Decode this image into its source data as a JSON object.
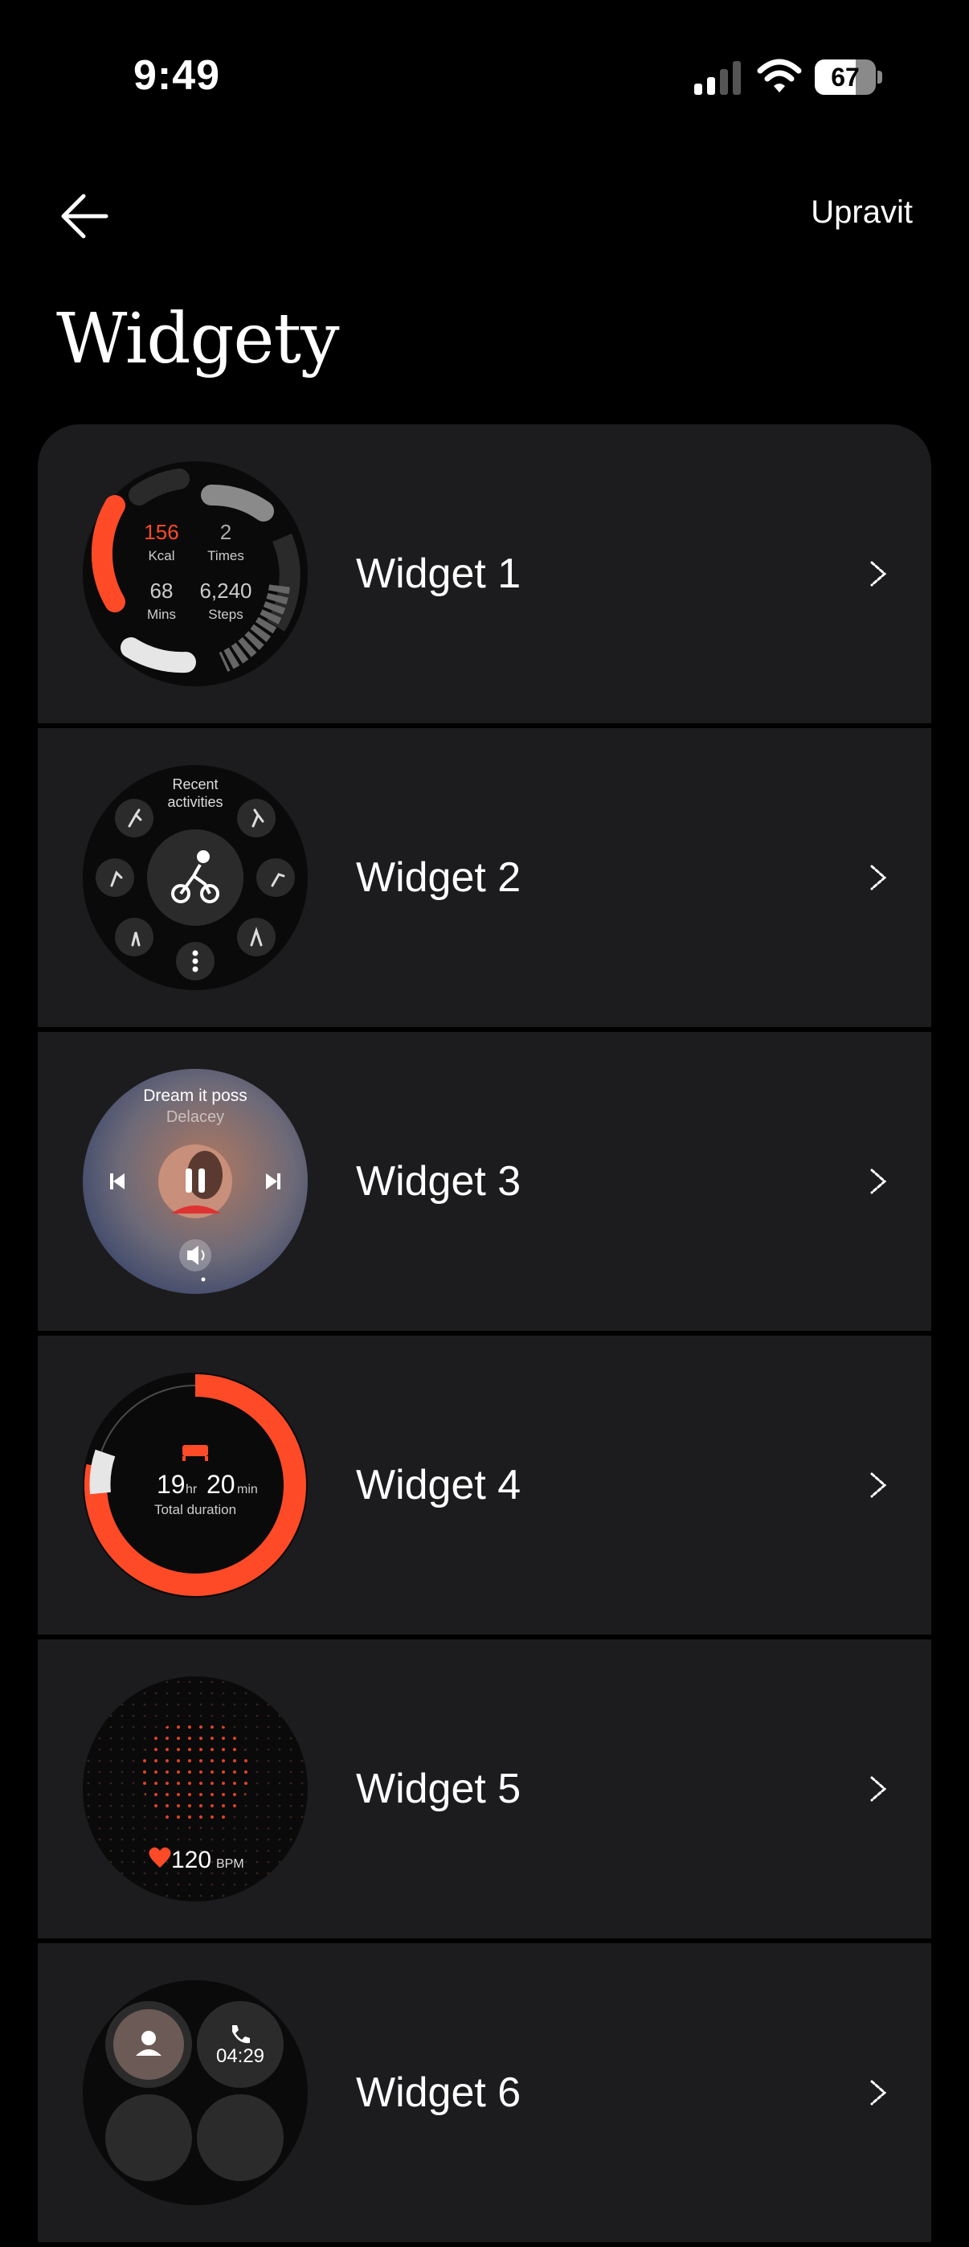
{
  "status_bar": {
    "time": "9:49",
    "battery": "67",
    "battery_level": 0.67
  },
  "header": {
    "edit_label": "Upravit",
    "title": "Widgety"
  },
  "widgets": [
    {
      "label": "Widget 1",
      "kcal": "156",
      "kcal_label": "Kcal",
      "times": "2",
      "times_label": "Times",
      "mins": "68",
      "mins_label": "Mins",
      "steps": "6,240",
      "steps_label": "Steps"
    },
    {
      "label": "Widget 2",
      "title_line1": "Recent",
      "title_line2": "activities"
    },
    {
      "label": "Widget 3",
      "song": "Dream it poss",
      "artist": "Delacey"
    },
    {
      "label": "Widget 4",
      "hours": "19",
      "hr_unit": "hr",
      "minutes": "20",
      "min_unit": "min",
      "caption": "Total duration",
      "progress": 0.78
    },
    {
      "label": "Widget 5",
      "bpm": "120",
      "bpm_unit": "BPM"
    },
    {
      "label": "Widget 6",
      "call_time": "04:29"
    }
  ],
  "colors": {
    "accent": "#ff4a28",
    "card_bg": "#1c1c1e",
    "background": "#000000"
  },
  "icons": [
    "back-arrow-icon",
    "chevron-right-icon",
    "cycling-icon",
    "pause-icon",
    "bed-icon",
    "heart-icon",
    "phone-icon",
    "contact-icon"
  ]
}
